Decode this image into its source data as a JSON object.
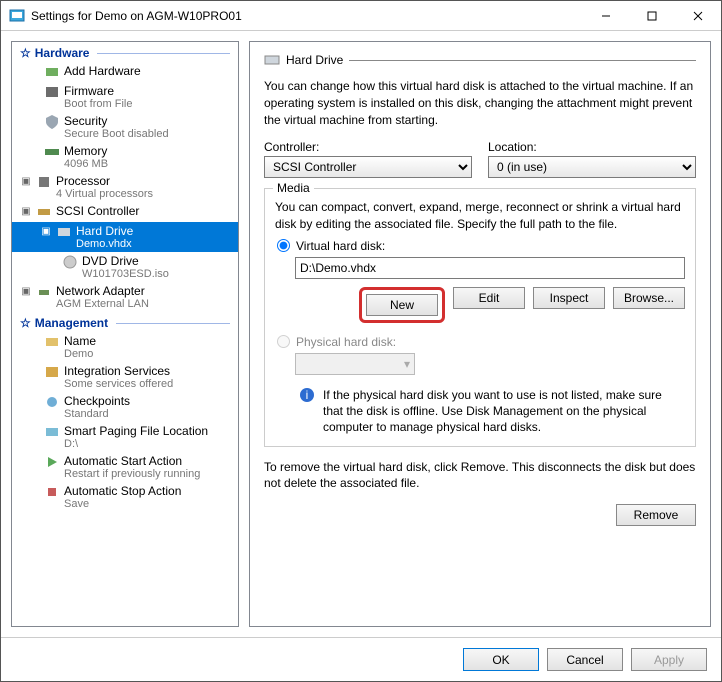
{
  "window": {
    "title": "Settings for Demo on AGM-W10PRO01"
  },
  "sections": {
    "hardware": "Hardware",
    "management": "Management"
  },
  "tree": {
    "add_hardware": "Add Hardware",
    "firmware": {
      "label": "Firmware",
      "sub": "Boot from File"
    },
    "security": {
      "label": "Security",
      "sub": "Secure Boot disabled"
    },
    "memory": {
      "label": "Memory",
      "sub": "4096 MB"
    },
    "processor": {
      "label": "Processor",
      "sub": "4 Virtual processors"
    },
    "scsi": {
      "label": "SCSI Controller"
    },
    "hard_drive": {
      "label": "Hard Drive",
      "sub": "Demo.vhdx"
    },
    "dvd_drive": {
      "label": "DVD Drive",
      "sub": "W101703ESD.iso"
    },
    "network": {
      "label": "Network Adapter",
      "sub": "AGM External LAN"
    },
    "name": {
      "label": "Name",
      "sub": "Demo"
    },
    "integration": {
      "label": "Integration Services",
      "sub": "Some services offered"
    },
    "checkpoints": {
      "label": "Checkpoints",
      "sub": "Standard"
    },
    "smart_paging": {
      "label": "Smart Paging File Location",
      "sub": "D:\\"
    },
    "auto_start": {
      "label": "Automatic Start Action",
      "sub": "Restart if previously running"
    },
    "auto_stop": {
      "label": "Automatic Stop Action",
      "sub": "Save"
    }
  },
  "right": {
    "title": "Hard Drive",
    "intro": "You can change how this virtual hard disk is attached to the virtual machine. If an operating system is installed on this disk, changing the attachment might prevent the virtual machine from starting.",
    "controller_label": "Controller:",
    "controller_value": "SCSI Controller",
    "location_label": "Location:",
    "location_value": "0 (in use)",
    "media_legend": "Media",
    "media_intro": "You can compact, convert, expand, merge, reconnect or shrink a virtual hard disk by editing the associated file. Specify the full path to the file.",
    "radio_vhd": "Virtual hard disk:",
    "vhd_path": "D:\\Demo.vhdx",
    "btn_new": "New",
    "btn_edit": "Edit",
    "btn_inspect": "Inspect",
    "btn_browse": "Browse...",
    "radio_phys": "Physical hard disk:",
    "phys_info": "If the physical hard disk you want to use is not listed, make sure that the disk is offline. Use Disk Management on the physical computer to manage physical hard disks.",
    "remove_text": "To remove the virtual hard disk, click Remove. This disconnects the disk but does not delete the associated file.",
    "btn_remove": "Remove"
  },
  "footer": {
    "ok": "OK",
    "cancel": "Cancel",
    "apply": "Apply"
  }
}
